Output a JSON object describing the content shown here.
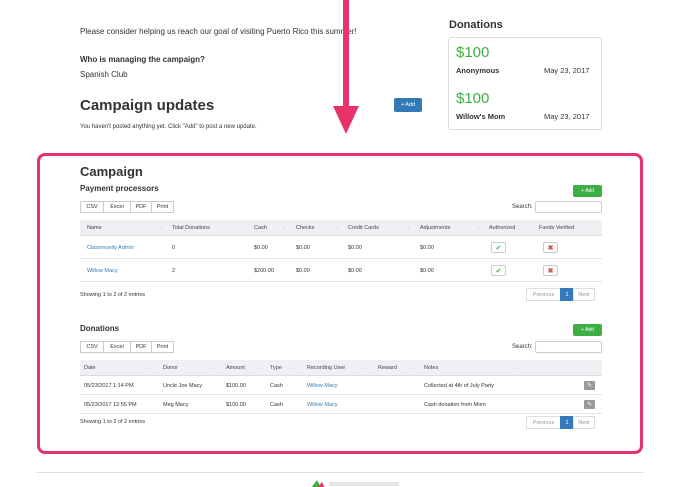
{
  "intro": "Please consider helping us reach our goal of visiting Puerto Rico this summer!",
  "manager": {
    "label": "Who is managing the campaign?",
    "value": "Spanish Club"
  },
  "updates": {
    "title": "Campaign updates",
    "add_label": "+ Add",
    "note": "You haven't posted anything yet. Click \"Add\" to post a new update."
  },
  "donations_sidebar": {
    "title": "Donations",
    "items": [
      {
        "amount": "$100",
        "name": "Anonymous",
        "date": "May 23, 2017"
      },
      {
        "amount": "$100",
        "name": "Willow's Mom",
        "date": "May 23, 2017"
      }
    ]
  },
  "campaign": {
    "title": "Campaign",
    "processors": {
      "title": "Payment processors",
      "add_label": "+ Add",
      "export": [
        "CSV",
        "Excel",
        "PDF",
        "Print"
      ],
      "search_label": "Search:",
      "columns": [
        "Name",
        "Total Donations",
        "Cash",
        "Checks",
        "Credit Cards",
        "Adjustments",
        "Authorized",
        "Funds Verified"
      ],
      "rows": [
        {
          "name": "Classmunity Admin",
          "total": "0",
          "cash": "$0.00",
          "checks": "$0.00",
          "credit": "$0.00",
          "adjust": "$0.00"
        },
        {
          "name": "Willow Macy",
          "total": "2",
          "cash": "$200.00",
          "checks": "$0.00",
          "credit": "$0.00",
          "adjust": "$0.00"
        }
      ],
      "showing": "Showing 1 to 2 of 2 entries",
      "pager": {
        "prev": "Previous",
        "page": "1",
        "next": "Next"
      }
    },
    "donations": {
      "title": "Donations",
      "add_label": "+ Add",
      "export": [
        "CSV",
        "Excel",
        "PDF",
        "Print"
      ],
      "search_label": "Search:",
      "columns": [
        "Date",
        "Donor",
        "Amount",
        "Type",
        "Recording User",
        "Reward",
        "Notes"
      ],
      "rows": [
        {
          "date": "05/23/2017 1:14 PM",
          "donor": "Uncle Joe Macy",
          "amount": "$100.00",
          "type": "Cash",
          "user": "Willow Macy",
          "reward": "",
          "notes": "Collected at 4th of July Party"
        },
        {
          "date": "05/23/2017 12:55 PM",
          "donor": "Meg Macy",
          "amount": "$100.00",
          "type": "Cash",
          "user": "Willow Macy",
          "reward": "",
          "notes": "Cash donation from Mom"
        }
      ],
      "showing": "Showing 1 to 2 of 2 entries",
      "pager": {
        "prev": "Previous",
        "page": "1",
        "next": "Next"
      }
    }
  },
  "colors": {
    "highlight": "#e8336a",
    "primary": "#337ab7",
    "success": "#3cb043"
  },
  "icons": {
    "check": "check-icon",
    "remove": "x-icon",
    "edit": "edit-icon",
    "arrow": "down-arrow-annotation"
  }
}
